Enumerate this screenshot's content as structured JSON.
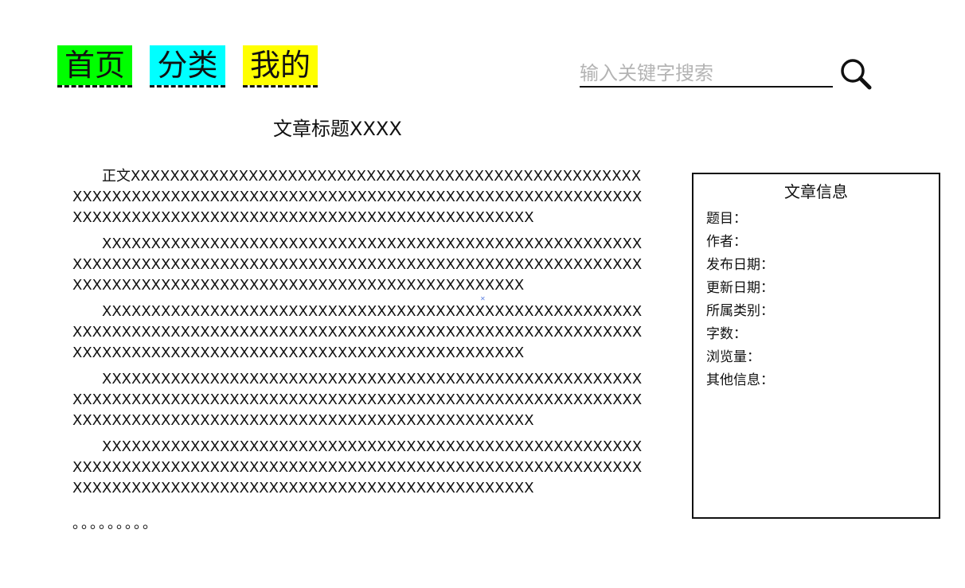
{
  "nav": {
    "tabs": [
      {
        "label": "首页",
        "bg": "#00ff00"
      },
      {
        "label": "分类",
        "bg": "#00ffff"
      },
      {
        "label": "我的",
        "bg": "#ffff00"
      }
    ]
  },
  "search": {
    "placeholder": "输入关键字搜索",
    "value": "",
    "icon": "search-icon"
  },
  "article": {
    "title": "文章标题XXXX",
    "paragraphs": [
      "正文XXXXXXXXXXXXXXXXXXXXXXXXXXXXXXXXXXXXXXXXXXXXXXXXXXXXXXXXXXXXXXXXXXXXXXXXXXXXXXXXXXXXXXXXXXXXXXXXXXXXXXXXXXXXXXXXXXXXXXXXXXXXXXXXXXXXXXXXXXXXXXXXXXXXXXXXXXXXX",
      "XXXXXXXXXXXXXXXXXXXXXXXXXXXXXXXXXXXXXXXXXXXXXXXXXXXXXXXXXXXXXXXXXXXXXXXXXXXXXXXXXXXXXXXXXXXXXXXXXXXXXXXXXXXXXXXXXXXXXXXXXXXXXXXXXXXXXXXXXXXXXXXXXXXXXXXXXXXXXXX",
      "XXXXXXXXXXXXXXXXXXXXXXXXXXXXXXXXXXXXXXXXXXXXXXXXXXXXXXXXXXXXXXXXXXXXXXXXXXXXXXXXXXXXXXXXXXXXXXXXXXXXXXXXXXXXXXXXXXXXXXXXXXXXXXXXXXXXXXXXXXXXXXXXXXXXXXXXXXXXXXX",
      "XXXXXXXXXXXXXXXXXXXXXXXXXXXXXXXXXXXXXXXXXXXXXXXXXXXXXXXXXXXXXXXXXXXXXXXXXXXXXXXXXXXXXXXXXXXXXXXXXXXXXXXXXXXXXXXXXXXXXXXXXXXXXXXXXXXXXXXXXXXXXXXXXXXXXXXXXXXXXXXX",
      "XXXXXXXXXXXXXXXXXXXXXXXXXXXXXXXXXXXXXXXXXXXXXXXXXXXXXXXXXXXXXXXXXXXXXXXXXXXXXXXXXXXXXXXXXXXXXXXXXXXXXXXXXXXXXXXXXXXXXXXXXXXXXXXXXXXXXXXXXXXXXXXXXXXXXXXXXXXXXXXX"
    ],
    "ellipsis": "。。。。。。。。。"
  },
  "info_panel": {
    "title": "文章信息",
    "items": [
      "题目：",
      "作者：",
      "发布日期：",
      "更新日期：",
      "所属类别：",
      "字数：",
      "浏览量：",
      "其他信息："
    ]
  }
}
